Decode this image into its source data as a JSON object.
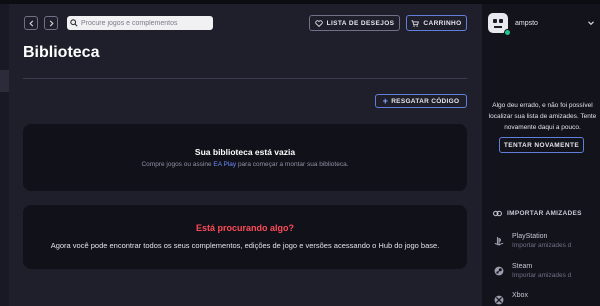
{
  "header": {
    "back_icon": "chevron-left-icon",
    "forward_icon": "chevron-right-icon",
    "search": {
      "placeholder": "Procure jogos e complementos",
      "icon": "search-icon"
    },
    "wishlist_label": "LISTA DE DESEJOS",
    "cart_label": "CARRINHO"
  },
  "main": {
    "title": "Biblioteca",
    "redeem_label": "RESGATAR CÓDIGO",
    "empty_library": {
      "heading": "Sua biblioteca está vazia",
      "text_before": "Compre jogos ou assine ",
      "link": "EA Play",
      "text_after": " para começar a montar sua biblioteca."
    },
    "looking": {
      "heading": "Está procurando algo?",
      "text": "Agora você pode encontrar todos os seus complementos, edições de jogo e versões acessando o Hub do jogo base."
    }
  },
  "sidebar": {
    "username": "ampsto",
    "status": "online",
    "error_text": "Algo deu errado, e não foi possível localizar sua lista de amizades. Tente novamente daqui a pouco.",
    "retry_label": "TENTAR NOVAMENTE",
    "import_label": "IMPORTAR AMIZADES",
    "platforms": [
      {
        "name": "PlayStation",
        "sub": "Importar amizades d",
        "icon": "playstation-icon"
      },
      {
        "name": "Steam",
        "sub": "Importar amizades d",
        "icon": "steam-icon"
      },
      {
        "name": "Xbox",
        "sub": "",
        "icon": "xbox-icon"
      }
    ]
  },
  "colors": {
    "background": "#1e1f2b",
    "card": "#111219",
    "sidebar": "#12131b",
    "accent_blue": "#5f7fd8",
    "link_blue": "#6d8dff",
    "alert_red": "#ff4a57",
    "online_green": "#22c38e"
  }
}
